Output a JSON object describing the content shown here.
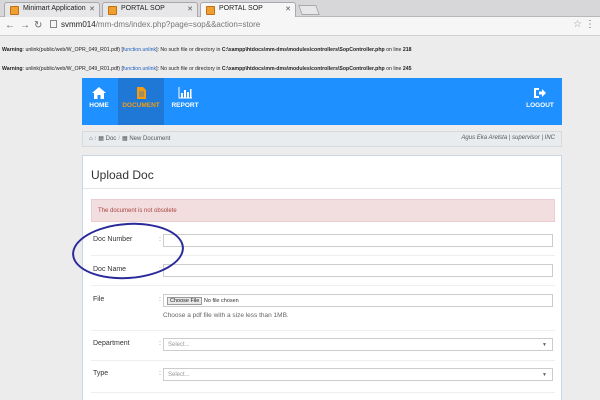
{
  "browser": {
    "tabs": [
      {
        "label": "Minimart Application",
        "active": false
      },
      {
        "label": "PORTAL SOP",
        "active": false
      },
      {
        "label": "PORTAL SOP",
        "active": true
      }
    ],
    "url_host": "svmm014",
    "url_path": "/mm-dms/index.php?page=sop&&action=store"
  },
  "warnings": [
    {
      "prefix": "Warning",
      "text1": ": unlink(public/web/W_OPR_049_R01.pdf) [",
      "link": "function.unlink",
      "text2": "]: No such file or directory in ",
      "file": "C:\\xampp\\htdocs\\mm-dms\\modules\\controllers\\SopController.php",
      "line_text": " on line ",
      "line": "218"
    },
    {
      "prefix": "Warning",
      "text1": ": unlink(public/web/W_OPR_049_R01.pdf) [",
      "link": "function.unlink",
      "text2": "]: No such file or directory in ",
      "file": "C:\\xampp\\htdocs\\mm-dms\\modules\\controllers\\SopController.php",
      "line_text": " on line ",
      "line": "245"
    }
  ],
  "nav": {
    "items": [
      {
        "label": "HOME",
        "icon": "home-icon"
      },
      {
        "label": "DOCUMENT",
        "icon": "document-icon",
        "active": true
      },
      {
        "label": "REPORT",
        "icon": "bar-chart-icon"
      }
    ],
    "logout": "LOGOUT"
  },
  "breadcrumb": {
    "items": [
      "Doc",
      "New Document"
    ],
    "user": "Agus Eka Arelsta | supervisor | INC"
  },
  "panel": {
    "title": "Upload Doc",
    "alert": "The document is not obsolete",
    "fields": {
      "doc_number": "Doc Number",
      "doc_name": "Doc Name",
      "file": "File",
      "file_button": "Choose File",
      "file_status": "No file chosen",
      "file_help": "Choose a pdf file with a size less than 1MB.",
      "department": "Department",
      "department_placeholder": "Select...",
      "type": "Type",
      "type_placeholder": "Select..."
    }
  },
  "colors": {
    "nav_bg": "#1e90ff",
    "nav_active_label": "#f39c12",
    "alert_bg": "#f2dede",
    "alert_text": "#a94442",
    "annotation_circle": "#2a2a9a"
  }
}
